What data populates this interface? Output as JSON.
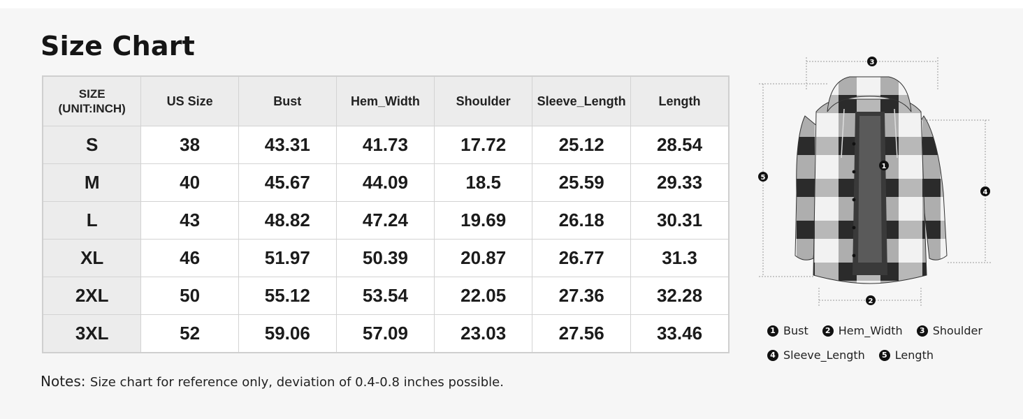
{
  "title": "Size Chart",
  "table": {
    "headers": [
      "SIZE",
      "(UNIT:INCH)",
      "US Size",
      "Bust",
      "Hem_Width",
      "Shoulder",
      "Sleeve_Length",
      "Length"
    ],
    "rows": [
      [
        "S",
        "38",
        "43.31",
        "41.73",
        "17.72",
        "25.12",
        "28.54"
      ],
      [
        "M",
        "40",
        "45.67",
        "44.09",
        "18.5",
        "25.59",
        "29.33"
      ],
      [
        "L",
        "43",
        "48.82",
        "47.24",
        "19.69",
        "26.18",
        "30.31"
      ],
      [
        "XL",
        "46",
        "51.97",
        "50.39",
        "20.87",
        "26.77",
        "31.3"
      ],
      [
        "2XL",
        "50",
        "55.12",
        "53.54",
        "22.05",
        "27.36",
        "32.28"
      ],
      [
        "3XL",
        "52",
        "59.06",
        "57.09",
        "23.03",
        "27.56",
        "33.46"
      ]
    ]
  },
  "notes": {
    "label": "Notes:",
    "text": "Size chart for reference only, deviation of 0.4-0.8 inches possible."
  },
  "figure": {
    "markers": [
      "1",
      "2",
      "3",
      "4",
      "5"
    ]
  },
  "legend": [
    {
      "num": "1",
      "label": "Bust"
    },
    {
      "num": "2",
      "label": "Hem_Width"
    },
    {
      "num": "3",
      "label": "Shoulder"
    },
    {
      "num": "4",
      "label": "Sleeve_Length"
    },
    {
      "num": "5",
      "label": "Length"
    }
  ],
  "colors": {
    "panel_bg": "#f6f6f6",
    "header_bg": "#ececec",
    "text": "#1a1a1a"
  }
}
